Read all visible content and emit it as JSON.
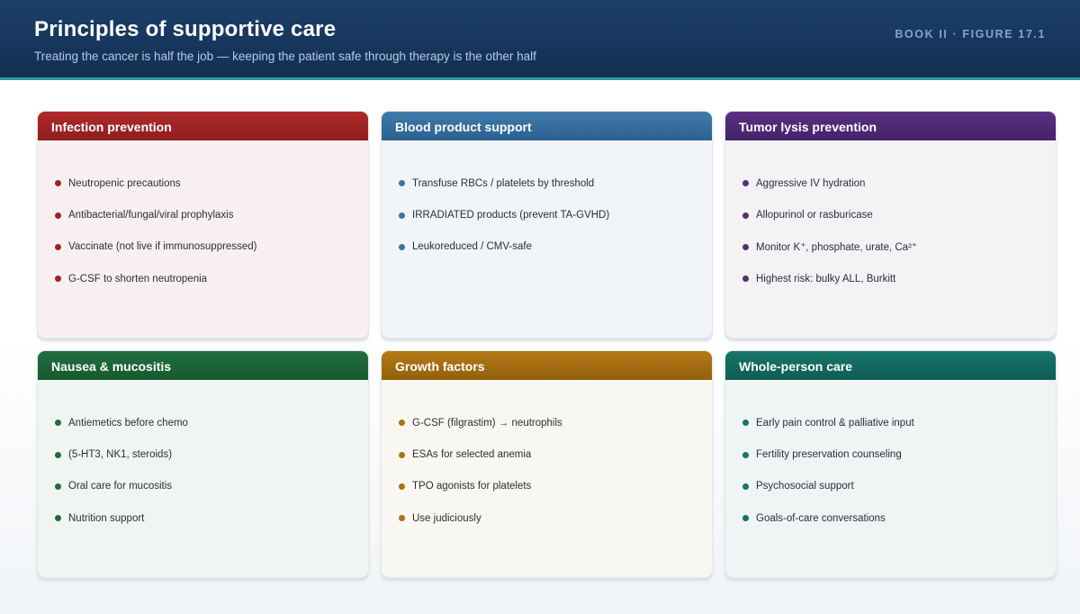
{
  "header": {
    "title": "Principles of supportive care",
    "subtitle": "Treating the cancer is half the job — keeping the patient safe through therapy is the other half",
    "figure_label": "BOOK II · FIGURE 17.1"
  },
  "colors": {
    "header_bg": "#132f52",
    "accent_rule": "#2a9d9a",
    "infection": "#9e2323",
    "blood": "#3a75a6",
    "tumor_lysis": "#55306f",
    "nausea": "#1f6b3c",
    "growth": "#a8740f",
    "whole_person": "#167468"
  },
  "cards": [
    {
      "title": "Infection prevention",
      "items": [
        "Neutropenic precautions",
        "Antibacterial/fungal/viral prophylaxis",
        "Vaccinate (not live if immunosuppressed)",
        "G-CSF to shorten neutropenia"
      ]
    },
    {
      "title": "Blood product support",
      "items": [
        "Transfuse RBCs / platelets by threshold",
        "IRRADIATED products (prevent TA-GVHD)",
        "Leukoreduced / CMV-safe"
      ]
    },
    {
      "title": "Tumor lysis prevention",
      "items": [
        "Aggressive IV hydration",
        "Allopurinol or rasburicase",
        "Monitor K⁺, phosphate, urate, Ca²⁺",
        "Highest risk: bulky ALL, Burkitt"
      ]
    },
    {
      "title": "Nausea & mucositis",
      "items": [
        "Antiemetics before chemo",
        "(5-HT3, NK1, steroids)",
        "Oral care for mucositis",
        "Nutrition support"
      ]
    },
    {
      "title": "Growth factors",
      "items": [
        "G-CSF (filgrastim) → neutrophils",
        "ESAs for selected anemia",
        "TPO agonists for platelets",
        "Use judiciously"
      ]
    },
    {
      "title": "Whole-person care",
      "items": [
        "Early pain control & palliative input",
        "Fertility preservation counseling",
        "Psychosocial support",
        "Goals-of-care conversations"
      ]
    }
  ]
}
